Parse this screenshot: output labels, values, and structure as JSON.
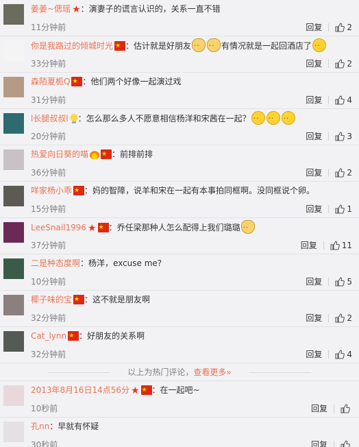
{
  "ui": {
    "reply_label": "回复"
  },
  "comments": [
    {
      "username": "姜姜~偲瑶",
      "badges": [
        "star"
      ],
      "text": "：演妻子的谎言认识的，关系一直不错",
      "emojis": [],
      "time": "11分钟前",
      "likes": "2",
      "avatar_color": "#6b6b5e"
    },
    {
      "username": "你是我路过的倾城时光",
      "badges": [
        "flag"
      ],
      "text": "：估计就是好朋友",
      "emojis": [
        "dog",
        "dog"
      ],
      "text2": "有情况就是一起回酒店了",
      "emojis2": [
        "laugh"
      ],
      "time": "33分钟前",
      "likes": "2",
      "avatar_color": "#f4f4f4"
    },
    {
      "username": "森陌夏栀Q",
      "badges": [
        "flag"
      ],
      "text": "：他们两个好像一起演过戏",
      "emojis": [],
      "time": "31分钟前",
      "likes": "4",
      "avatar_color": "#b59a85"
    },
    {
      "username": "l长腿叔叔l",
      "badges": [
        "bulb"
      ],
      "text": "：怎么那么多人不愿意相信杨洋和宋茜在一起？",
      "emojis": [
        "face",
        "face",
        "face"
      ],
      "time": "20分钟前",
      "likes": "3",
      "avatar_color": "#2d6b70"
    },
    {
      "username": "热爱向日葵的喵",
      "badges": [
        "fire",
        "flag"
      ],
      "text": "：前排前排",
      "emojis": [],
      "time": "36分钟前",
      "likes": "2",
      "avatar_color": "#c9c2c4"
    },
    {
      "username": "咩家杨小乖",
      "badges": [
        "flag"
      ],
      "text": "：妈的智障，说羊和宋在一起有本事拍同框啊。没同框说个卵。",
      "emojis": [],
      "time": "15分钟前",
      "likes": "1",
      "avatar_color": "#5c5a55"
    },
    {
      "username": "LeeSnail1996",
      "badges": [
        "star",
        "flag"
      ],
      "text": "：乔任梁那种人怎么配得上我们璐璐",
      "emojis": [
        "dog"
      ],
      "time": "37分钟前",
      "likes": "11",
      "avatar_color": "#6a2a55"
    },
    {
      "username": "二是种态度啊",
      "badges": [],
      "text": "：杨洋，excuse me?",
      "emojis": [],
      "time": "10分钟前",
      "likes": "5",
      "avatar_color": "#3b5b4a"
    },
    {
      "username": "椰子味的宝",
      "badges": [
        "flag"
      ],
      "text": "：这不就是朋友啊",
      "emojis": [],
      "time": "32分钟前",
      "likes": "2",
      "avatar_color": "#8a8080"
    },
    {
      "username": "Cat_lynn",
      "badges": [
        "flag"
      ],
      "text": "：好朋友的关系啊",
      "emojis": [],
      "time": "32分钟前",
      "likes": "4",
      "avatar_color": "#555a55"
    }
  ],
  "more_bar": {
    "text": "以上为热门评论，",
    "link": "查看更多»"
  },
  "recent": [
    {
      "username": "2013年8月16日14点56分",
      "badges": [
        "star",
        "flag"
      ],
      "text": "：在一起吧~",
      "emojis": [],
      "time": "10秒前",
      "avatar_color": "#e8d8dc"
    },
    {
      "username": "孔nn",
      "badges": [],
      "text": "：早就有怀疑",
      "emojis": [],
      "time": "30秒前",
      "avatar_color": "#e4e0e4"
    }
  ]
}
